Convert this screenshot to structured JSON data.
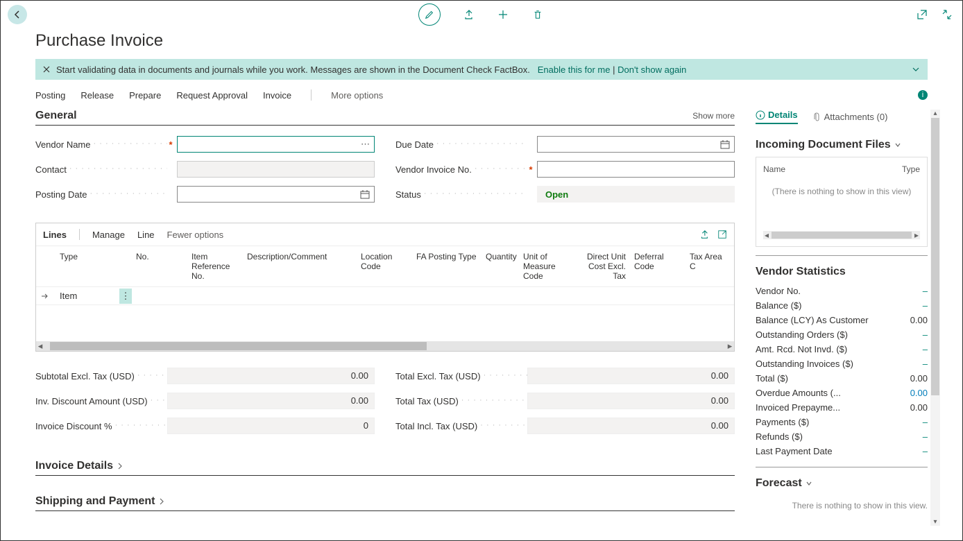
{
  "page_title": "Purchase Invoice",
  "notification": {
    "text": "Start validating data in documents and journals while you work. Messages are shown in the Document Check FactBox.",
    "enable_link": "Enable this for me",
    "dont_show": "Don't show again"
  },
  "actions": {
    "posting": "Posting",
    "release": "Release",
    "prepare": "Prepare",
    "request_approval": "Request Approval",
    "invoice": "Invoice",
    "more": "More options"
  },
  "general": {
    "title": "General",
    "show_more": "Show more",
    "labels": {
      "vendor_name": "Vendor Name",
      "contact": "Contact",
      "posting_date": "Posting Date",
      "due_date": "Due Date",
      "vendor_invoice_no": "Vendor Invoice No.",
      "status": "Status"
    },
    "values": {
      "vendor_name": "",
      "contact": "",
      "posting_date": "",
      "due_date": "",
      "vendor_invoice_no": "",
      "status": "Open"
    }
  },
  "lines": {
    "title": "Lines",
    "manage": "Manage",
    "line": "Line",
    "fewer": "Fewer options",
    "columns": {
      "type": "Type",
      "no": "No.",
      "item_ref": "Item Reference No.",
      "desc": "Description/Comment",
      "location": "Location Code",
      "fa_posting": "FA Posting Type",
      "quantity": "Quantity",
      "uom": "Unit of Measure Code",
      "direct_cost": "Direct Unit Cost Excl. Tax",
      "deferral": "Deferral Code",
      "tax_area": "Tax Area C"
    },
    "row": {
      "type": "Item"
    }
  },
  "totals": {
    "subtotal_label": "Subtotal Excl. Tax (USD)",
    "subtotal": "0.00",
    "inv_disc_label": "Inv. Discount Amount (USD)",
    "inv_disc": "0.00",
    "inv_pct_label": "Invoice Discount %",
    "inv_pct": "0",
    "total_excl_label": "Total Excl. Tax (USD)",
    "total_excl": "0.00",
    "total_tax_label": "Total Tax (USD)",
    "total_tax": "0.00",
    "total_incl_label": "Total Incl. Tax (USD)",
    "total_incl": "0.00"
  },
  "sections": {
    "invoice_details": "Invoice Details",
    "shipping_payment": "Shipping and Payment"
  },
  "side": {
    "details_tab": "Details",
    "attachments_tab": "Attachments (0)",
    "incoming_title": "Incoming Document Files",
    "inc_name": "Name",
    "inc_type": "Type",
    "inc_empty": "(There is nothing to show in this view)",
    "vendor_stats": "Vendor Statistics",
    "vs": {
      "vendor_no": "Vendor No.",
      "balance": "Balance ($)",
      "balance_lcy": "Balance (LCY) As Customer",
      "balance_lcy_val": "0.00",
      "outstanding_orders": "Outstanding Orders ($)",
      "amt_rcd": "Amt. Rcd. Not Invd. ($)",
      "outstanding_inv": "Outstanding Invoices ($)",
      "total": "Total ($)",
      "total_val": "0.00",
      "overdue": "Overdue Amounts (...",
      "overdue_val": "0.00",
      "invoiced_pre": "Invoiced Prepayme...",
      "invoiced_pre_val": "0.00",
      "payments": "Payments ($)",
      "refunds": "Refunds ($)",
      "last_payment": "Last Payment Date"
    },
    "forecast": "Forecast",
    "forecast_empty": "There is nothing to show in this view."
  }
}
